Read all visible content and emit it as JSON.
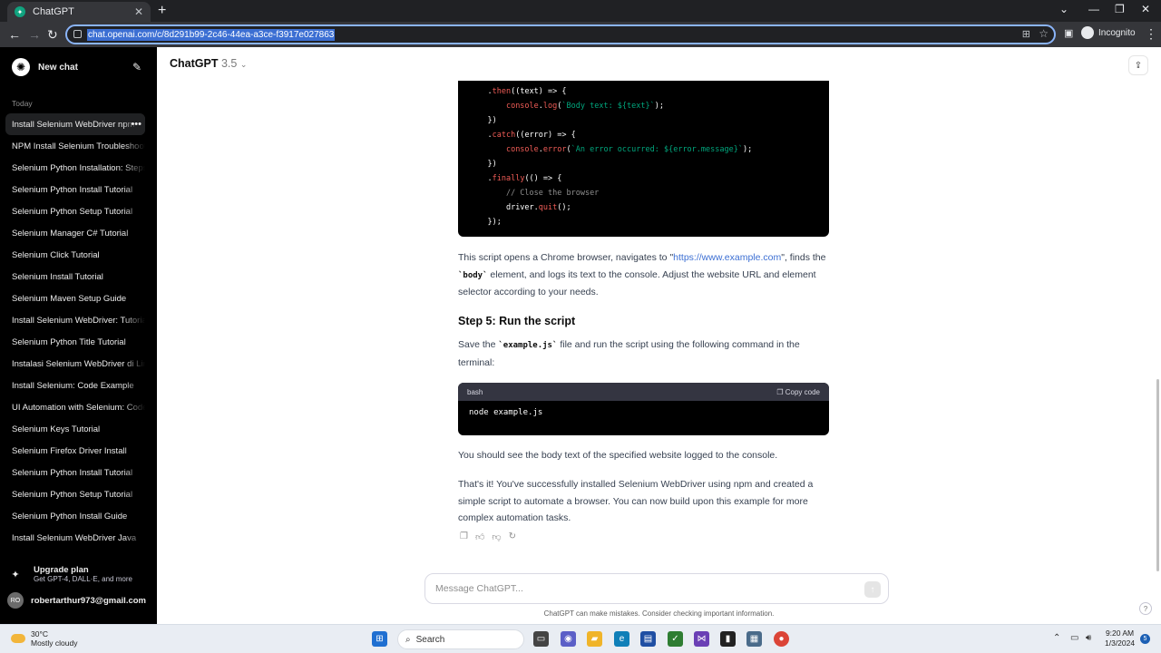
{
  "browser": {
    "tab_title": "ChatGPT",
    "url": "chat.openai.com/c/8d291b99-2c46-44ea-a3ce-f3917e027863",
    "incognito_label": "Incognito"
  },
  "sidebar": {
    "new_chat": "New chat",
    "section": "Today",
    "items": [
      "Install Selenium WebDriver npm",
      "NPM Install Selenium Troubleshooting",
      "Selenium Python Installation: Steps",
      "Selenium Python Install Tutorial",
      "Selenium Python Setup Tutorial",
      "Selenium Manager C# Tutorial",
      "Selenium Click Tutorial",
      "Selenium Install Tutorial",
      "Selenium Maven Setup Guide",
      "Install Selenium WebDriver: Tutorial",
      "Selenium Python Title Tutorial",
      "Instalasi Selenium WebDriver di Linux",
      "Install Selenium: Code Example",
      "UI Automation with Selenium: Code",
      "Selenium Keys Tutorial",
      "Selenium Firefox Driver Install",
      "Selenium Python Install Tutorial",
      "Selenium Python Setup Tutorial",
      "Selenium Python Install Guide",
      "Install Selenium WebDriver Java"
    ],
    "upgrade_title": "Upgrade plan",
    "upgrade_sub": "Get GPT-4, DALL·E, and more",
    "avatar_initials": "RO",
    "user_email": "robertarthur973@gmail.com"
  },
  "header": {
    "model_name": "ChatGPT",
    "model_version": "3.5"
  },
  "code": {
    "lines": [
      {
        "indent": "    ",
        "parts": [
          [
            ".",
            ""
          ],
          [
            "then",
            "kw"
          ],
          [
            "((text) => {",
            ""
          ]
        ]
      },
      {
        "indent": "        ",
        "parts": [
          [
            "console",
            "kw"
          ],
          [
            ".",
            ""
          ],
          [
            "log",
            "kw"
          ],
          [
            "(",
            ""
          ],
          [
            "`Body text: ${text}`",
            "str"
          ],
          [
            ");",
            ""
          ]
        ]
      },
      {
        "indent": "    ",
        "parts": [
          [
            "})",
            ""
          ]
        ]
      },
      {
        "indent": "    ",
        "parts": [
          [
            ".",
            ""
          ],
          [
            "catch",
            "kw"
          ],
          [
            "((error) => {",
            ""
          ]
        ]
      },
      {
        "indent": "        ",
        "parts": [
          [
            "console",
            "kw"
          ],
          [
            ".",
            ""
          ],
          [
            "error",
            "kw"
          ],
          [
            "(",
            ""
          ],
          [
            "`An error occurred: ${error.message}`",
            "str"
          ],
          [
            ");",
            ""
          ]
        ]
      },
      {
        "indent": "    ",
        "parts": [
          [
            "})",
            ""
          ]
        ]
      },
      {
        "indent": "    ",
        "parts": [
          [
            ".",
            ""
          ],
          [
            "finally",
            "kw"
          ],
          [
            "(() => {",
            ""
          ]
        ]
      },
      {
        "indent": "        ",
        "parts": [
          [
            "// Close the browser",
            "cm"
          ]
        ]
      },
      {
        "indent": "        ",
        "parts": [
          [
            "driver.",
            ""
          ],
          [
            "quit",
            "kw"
          ],
          [
            "();",
            ""
          ]
        ]
      },
      {
        "indent": "    ",
        "parts": [
          [
            "});",
            ""
          ]
        ]
      }
    ]
  },
  "message": {
    "p1_a": "This script opens a Chrome browser, navigates to \"",
    "p1_link": "https://www.example.com",
    "p1_b": "\", finds the",
    "p1_code": "`body`",
    "p1_c": " element, and logs its text to the console. Adjust the website URL and element selector according to your needs.",
    "step_heading": "Step 5: Run the script",
    "p2_a": "Save the ",
    "p2_code": "`example.js`",
    "p2_b": " file and run the script using the following command in the terminal:",
    "bash_lang": "bash",
    "copy_label": "Copy code",
    "bash_cmd": "node example.js",
    "p3": "You should see the body text of the specified website logged to the console.",
    "p4": "That's it! You've successfully installed Selenium WebDriver using npm and created a simple script to automate a browser. You can now build upon this example for more complex automation tasks."
  },
  "composer": {
    "placeholder": "Message ChatGPT...",
    "disclaimer": "ChatGPT can make mistakes. Consider checking important information.",
    "help": "?"
  },
  "taskbar": {
    "temp": "30°C",
    "weather": "Mostly cloudy",
    "search": "Search",
    "time": "9:20 AM",
    "date": "1/3/2024",
    "notif_count": "5"
  }
}
